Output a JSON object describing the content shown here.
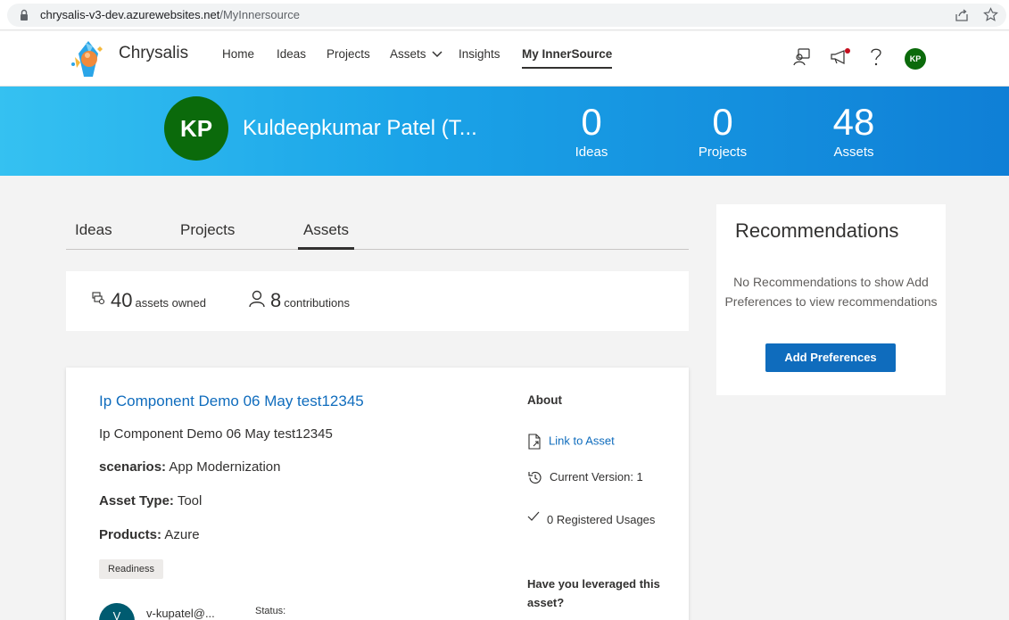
{
  "browser": {
    "url_host": "chrysalis-v3-dev.azurewebsites.net",
    "url_path": "/MyInnersource"
  },
  "nav": {
    "brand": "Chrysalis",
    "links": {
      "home": "Home",
      "ideas": "Ideas",
      "projects": "Projects",
      "assets": "Assets",
      "insights": "Insights",
      "my_innersource": "My InnerSource"
    },
    "active": "My InnerSource",
    "avatar_initials": "KP"
  },
  "hero": {
    "initials": "KP",
    "name": "Kuldeepkumar Patel (T...",
    "stats": {
      "ideas": {
        "value": "0",
        "label": "Ideas"
      },
      "projects": {
        "value": "0",
        "label": "Projects"
      },
      "assets": {
        "value": "48",
        "label": "Assets"
      }
    }
  },
  "tabs": {
    "ideas": "Ideas",
    "projects": "Projects",
    "assets": "Assets",
    "active": "Assets"
  },
  "summary": {
    "owned_count": "40",
    "owned_label": "assets owned",
    "contrib_count": "8",
    "contrib_label": "contributions"
  },
  "asset": {
    "title": "Ip Component Demo 06 May test12345",
    "description": "Ip Component Demo 06 May test12345",
    "scenarios_label": "scenarios:",
    "scenarios_value": "App Modernization",
    "type_label": "Asset Type:",
    "type_value": "Tool",
    "products_label": "Products:",
    "products_value": "Azure",
    "badge": "Readiness",
    "owner_initial": "V",
    "owner_email": "v-kupatel@...",
    "status_label": "Status:",
    "about": {
      "heading": "About",
      "link": "Link to Asset",
      "version": "Current Version: 1",
      "usages": "0 Registered Usages",
      "leverage": "Have you leveraged this asset?"
    }
  },
  "recommendations": {
    "title": "Recommendations",
    "message": "No Recommendations to show Add Preferences to view recommendations",
    "button": "Add Preferences"
  },
  "colors": {
    "accent": "#0f6cbd",
    "avatar": "#0b6a0b",
    "hero_start": "#35c1f1",
    "hero_end": "#0f7fd6"
  }
}
